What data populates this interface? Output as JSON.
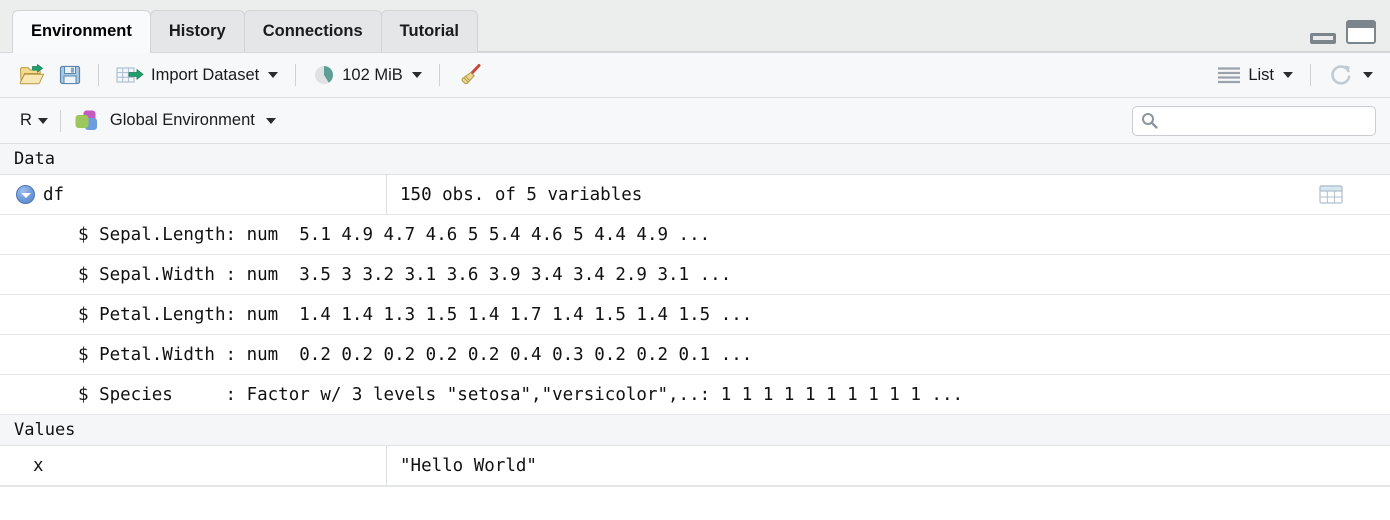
{
  "window": {
    "minimize_label": "minimize",
    "maximize_label": "maximize"
  },
  "tabs": [
    {
      "label": "Environment",
      "active": true
    },
    {
      "label": "History",
      "active": false
    },
    {
      "label": "Connections",
      "active": false
    },
    {
      "label": "Tutorial",
      "active": false
    }
  ],
  "toolbar": {
    "load_workspace_label": "",
    "save_workspace_label": "",
    "import_dataset_label": "Import Dataset",
    "memory_label": "102 MiB",
    "clear_label": "",
    "view_mode_label": "List",
    "refresh_label": ""
  },
  "envbar": {
    "language_label": "R",
    "scope_label": "Global Environment",
    "search_value": "",
    "search_placeholder": ""
  },
  "grid": {
    "sections": [
      {
        "title": "Data",
        "rows": [
          {
            "kind": "object",
            "name": "df",
            "value": "150 obs. of 5 variables",
            "expanded": true,
            "has_view_icon": true
          },
          {
            "kind": "detail",
            "text": "$ Sepal.Length: num  5.1 4.9 4.7 4.6 5 5.4 4.6 5 4.4 4.9 ..."
          },
          {
            "kind": "detail",
            "text": "$ Sepal.Width : num  3.5 3 3.2 3.1 3.6 3.9 3.4 3.4 2.9 3.1 ..."
          },
          {
            "kind": "detail",
            "text": "$ Petal.Length: num  1.4 1.4 1.3 1.5 1.4 1.7 1.4 1.5 1.4 1.5 ..."
          },
          {
            "kind": "detail",
            "text": "$ Petal.Width : num  0.2 0.2 0.2 0.2 0.2 0.4 0.3 0.2 0.2 0.1 ..."
          },
          {
            "kind": "detail",
            "text": "$ Species     : Factor w/ 3 levels \"setosa\",\"versicolor\",..: 1 1 1 1 1 1 1 1 1 1 ..."
          }
        ]
      },
      {
        "title": "Values",
        "rows": [
          {
            "kind": "object",
            "name": "x",
            "value": "\"Hello World\"",
            "expanded": false,
            "has_view_icon": false
          }
        ]
      }
    ]
  },
  "colors": {
    "tab_active_bg": "#f9fafb",
    "tab_inactive_bg": "#e4e6e7",
    "toolbar_bg": "#f7f8f9",
    "grid_bg": "#ffffff",
    "section_header_bg": "#f4f6f7",
    "expander_blue": "#6e9ad8",
    "folder_yellow": "#f0d386",
    "arrow_green": "#22a06b",
    "save_blue": "#7fa8cf",
    "memory_teal": "#5e9e95",
    "broom_tan": "#e3d08f",
    "scope_green": "#9cc75a",
    "scope_purple": "#c45bc0",
    "scope_blue": "#6c9ede"
  }
}
